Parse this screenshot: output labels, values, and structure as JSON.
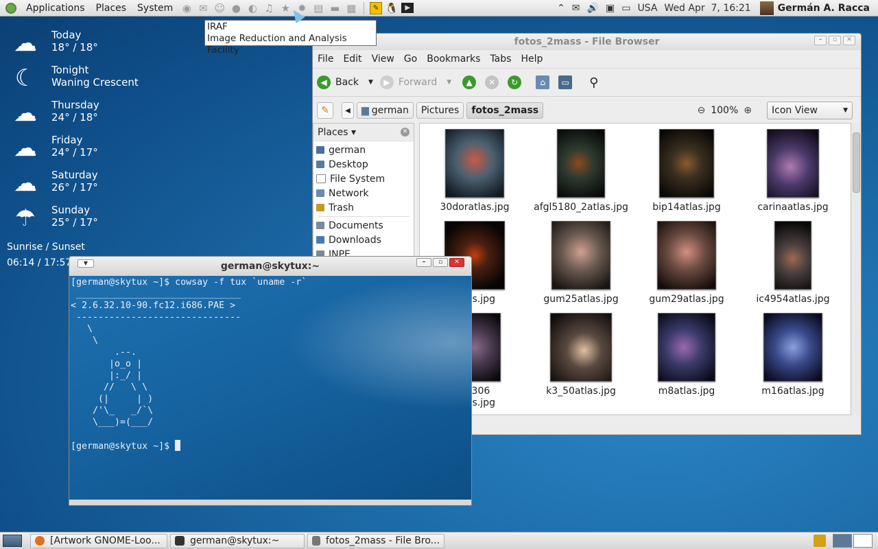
{
  "top_panel": {
    "menus": [
      "Applications",
      "Places",
      "System"
    ],
    "launchers": [
      "firefox-icon",
      "mail-icon",
      "chat-icon",
      "pidgin-icon",
      "audio-icon",
      "music-icon",
      "bookmark-icon",
      "settings-icon",
      "document-icon",
      "folder-icon",
      "calculator-icon"
    ],
    "keyboard_layout": "USA",
    "clock": "Wed Apr  7, 16:21",
    "user_name": "Germán A. Racca"
  },
  "tooltip": {
    "title": "IRAF",
    "description": "Image Reduction and Analysis Facility"
  },
  "weather": {
    "rows": [
      {
        "day": "Today",
        "temp": "18° / 18°",
        "icon": "partly-cloudy-icon"
      },
      {
        "day": "Tonight",
        "temp": "Waning Crescent",
        "icon": "moon-icon"
      },
      {
        "day": "Thursday",
        "temp": "24° / 18°",
        "icon": "partly-cloudy-icon"
      },
      {
        "day": "Friday",
        "temp": "24° / 17°",
        "icon": "partly-cloudy-icon"
      },
      {
        "day": "Saturday",
        "temp": "26° / 17°",
        "icon": "partly-cloudy-icon"
      },
      {
        "day": "Sunday",
        "temp": "25° / 17°",
        "icon": "rain-icon"
      }
    ],
    "sun_label": "Sunrise / Sunset",
    "sun_times": "06:14 / 17:57"
  },
  "file_browser": {
    "title": "fotos_2mass - File Browser",
    "menus": [
      "File",
      "Edit",
      "View",
      "Go",
      "Bookmarks",
      "Tabs",
      "Help"
    ],
    "toolbar": {
      "back": "Back",
      "forward": "Forward"
    },
    "breadcrumbs": [
      "german",
      "Pictures",
      "fotos_2mass"
    ],
    "zoom": "100%",
    "view_mode": "Icon View",
    "sidebar_title": "Places ▾",
    "sidebar_items": [
      {
        "label": "german",
        "color": "#4a6f9c"
      },
      {
        "label": "Desktop",
        "color": "#5a7a9a"
      },
      {
        "label": "File System",
        "color": "#8a8a8a"
      },
      {
        "label": "Network",
        "color": "#6a8ab0"
      },
      {
        "label": "Trash",
        "color": "#c59a20"
      },
      {
        "label": "Documents",
        "color": "#7a8a9a"
      },
      {
        "label": "Downloads",
        "color": "#4a7ab0"
      },
      {
        "label": "INPE",
        "color": "#7a8a9a"
      }
    ],
    "files": [
      {
        "name": "30doratlas.jpg",
        "tint": "#4a6070"
      },
      {
        "name": "afgl5180_2atlas.jpg",
        "tint": "#2e3a30"
      },
      {
        "name": "bip14atlas.jpg",
        "tint": "#3a3020"
      },
      {
        "name": "carinaatlas.jpg",
        "tint": "#4a3a6a"
      },
      {
        "name": "atlas.jpg",
        "tint": "#4a2010"
      },
      {
        "name": "gum25atlas.jpg",
        "tint": "#6a5a50"
      },
      {
        "name": "gum29atlas.jpg",
        "tint": "#6a4a40"
      },
      {
        "name": "ic4954atlas.jpg",
        "tint": "#4a4040"
      },
      {
        "name": "20306\natlas.jpg",
        "tint": "#4a3a50"
      },
      {
        "name": "k3_50atlas.jpg",
        "tint": "#5a4a40"
      },
      {
        "name": "m8atlas.jpg",
        "tint": "#3a3a6a"
      },
      {
        "name": "m16atlas.jpg",
        "tint": "#3a4a8a"
      }
    ]
  },
  "terminal": {
    "title": "german@skytux:~",
    "lines": [
      "[german@skytux ~]$ cowsay -f tux `uname -r`",
      " ______________________________",
      "< 2.6.32.10-90.fc12.i686.PAE >",
      " ------------------------------",
      "   \\",
      "    \\",
      "        .--.",
      "       |o_o |",
      "       |:_/ |",
      "      //   \\ \\",
      "     (|     | )",
      "    /'\\_   _/`\\",
      "    \\___)=(___/",
      "",
      "[german@skytux ~]$ "
    ]
  },
  "bottom_panel": {
    "tasks": [
      {
        "label": "[Artwork GNOME-Loo...",
        "icon_color": "#e07020"
      },
      {
        "label": "german@skytux:~",
        "icon_color": "#333333"
      },
      {
        "label": "fotos_2mass - File Bro...",
        "icon_color": "#777777"
      }
    ]
  }
}
